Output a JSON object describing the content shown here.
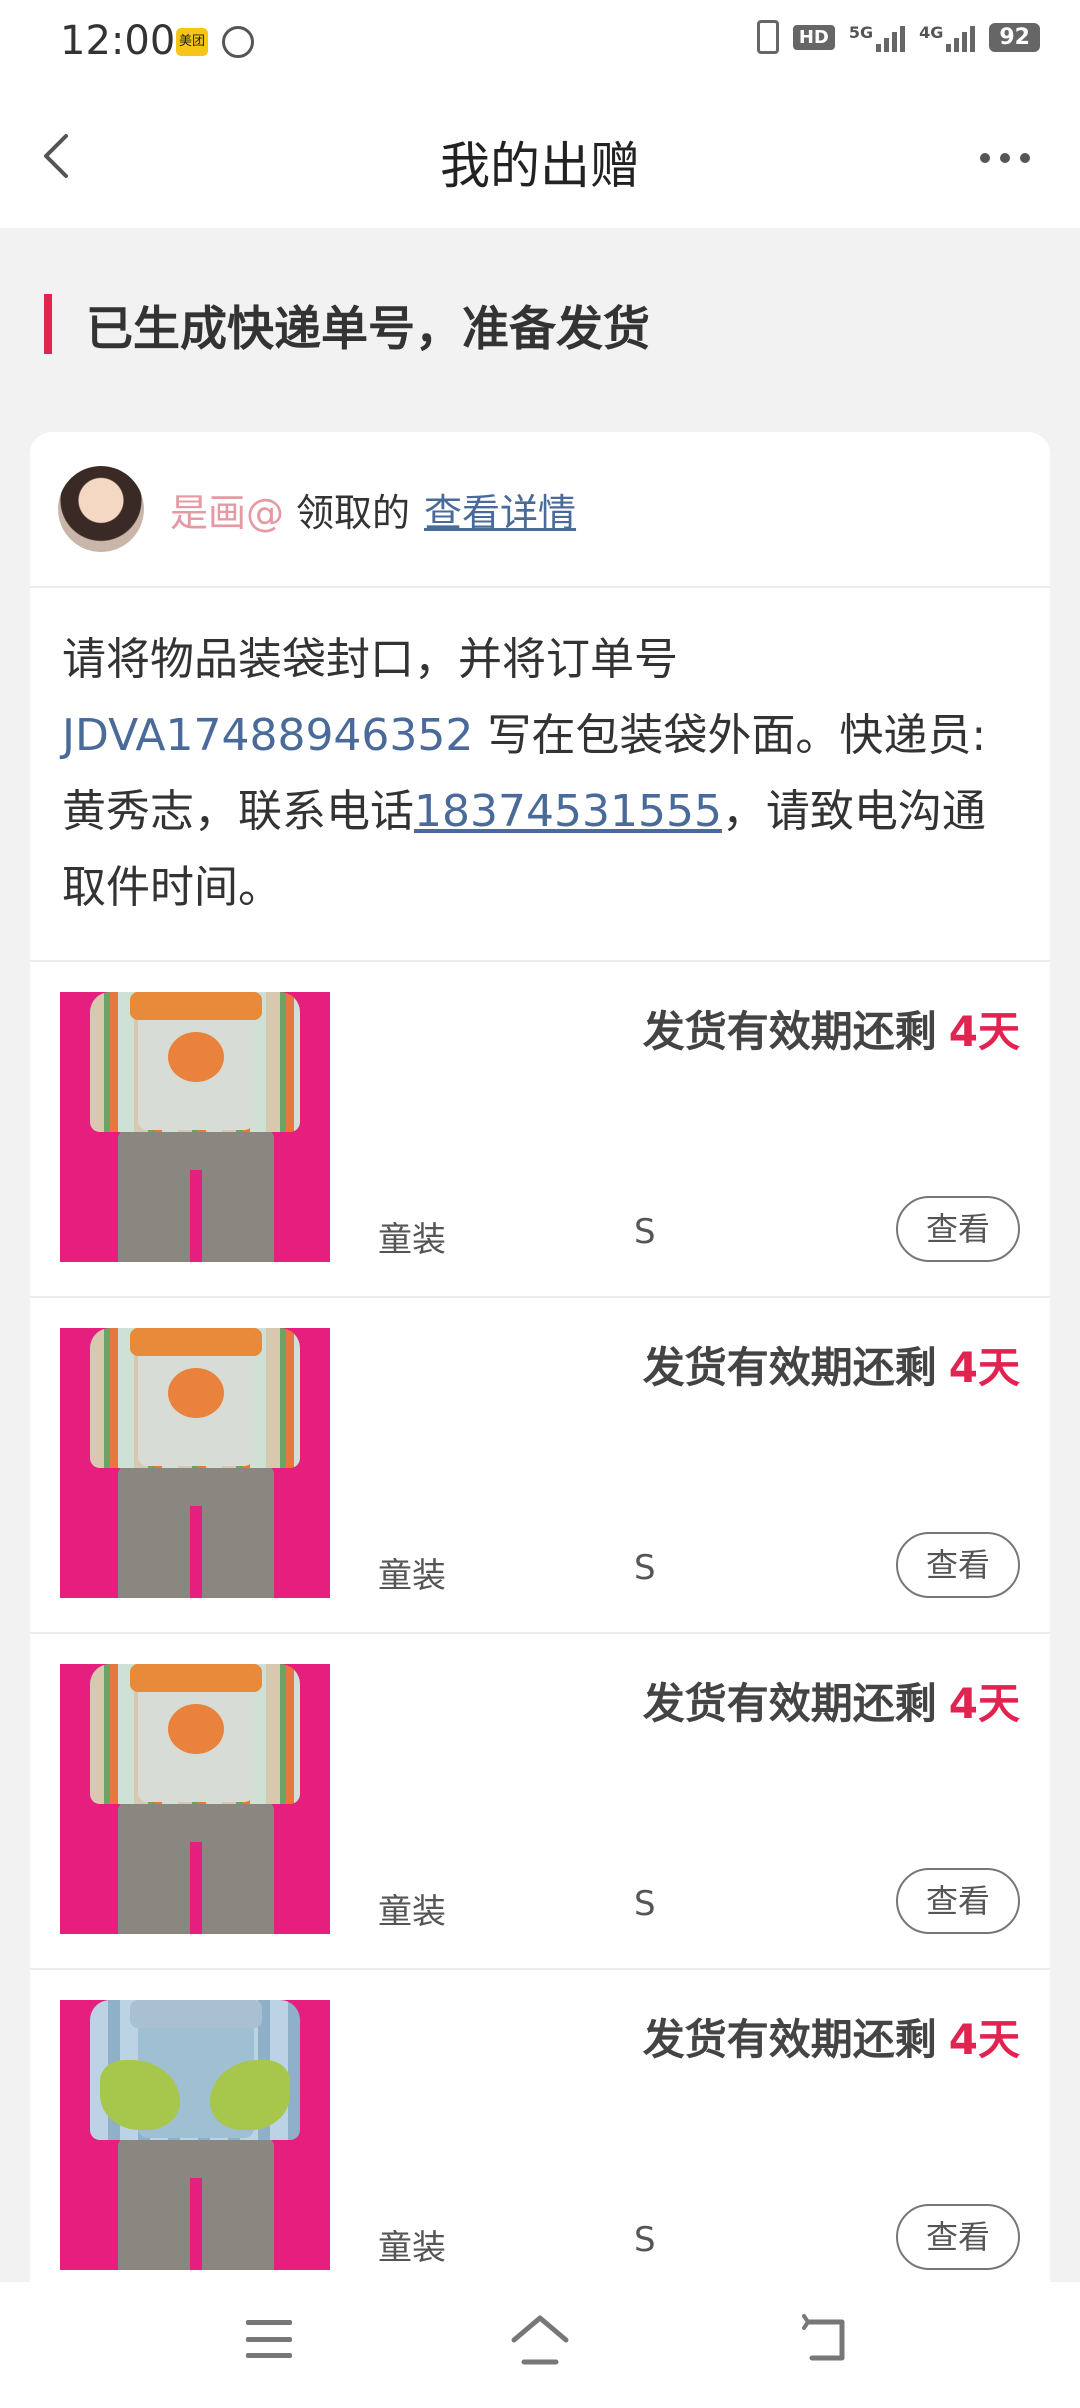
{
  "status_bar": {
    "time": "12:00",
    "app1_label": "美团",
    "hd_label": "HD",
    "sig1_label": "5G",
    "sig2_label": "4G",
    "battery": "92"
  },
  "header": {
    "title": "我的出赠",
    "back_icon": "chevron-left-icon",
    "more_icon": "more-horizontal-icon"
  },
  "section": {
    "heading": "已生成快递单号，准备发货",
    "accent_color": "#e0244f"
  },
  "claim": {
    "user": "是画@",
    "text": "领取的",
    "link": "查看详情"
  },
  "instructions": {
    "part1": "请将物品装袋封口，并将订单号 ",
    "order_no": "JDVA17488946352",
    "part2": " 写在包装袋外面。快递员:黄秀志，联系电话",
    "phone": "18374531555",
    "part3": "，请致电沟通取件时间。"
  },
  "items": [
    {
      "deadline_label": "发货有效期还剩",
      "days": "4天",
      "category": "童装",
      "size": "S",
      "view_label": "查看"
    },
    {
      "deadline_label": "发货有效期还剩",
      "days": "4天",
      "category": "童装",
      "size": "S",
      "view_label": "查看"
    },
    {
      "deadline_label": "发货有效期还剩",
      "days": "4天",
      "category": "童装",
      "size": "S",
      "view_label": "查看"
    },
    {
      "deadline_label": "发货有效期还剩",
      "days": "4天",
      "category": "童装",
      "size": "S",
      "view_label": "查看"
    }
  ],
  "nav": {
    "menu_icon": "menu-icon",
    "home_icon": "home-icon",
    "back_icon": "back-icon"
  }
}
